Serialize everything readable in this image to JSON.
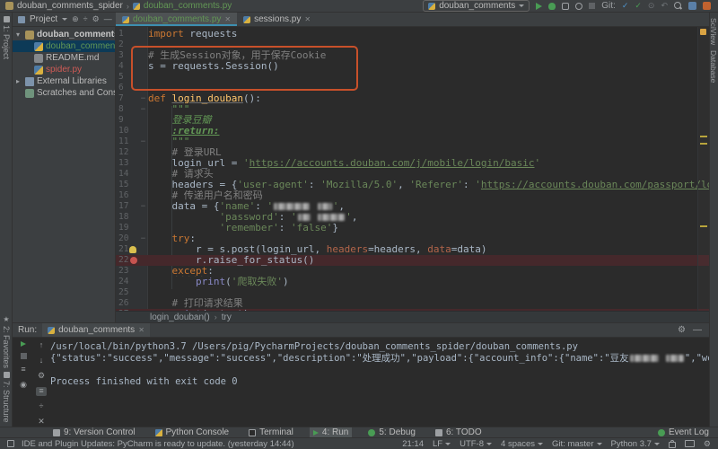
{
  "icons": {
    "close": "✕",
    "collapse": "÷",
    "gear": "⚙",
    "minus": "—",
    "check": "✓",
    "undo": "↶",
    "circle": "⊙",
    "up": "↑",
    "down": "↓",
    "star": "★",
    "sep": "›",
    "fold": "−",
    "menu": "≡",
    "pin": "◉",
    "print": "⎙",
    "trash": "🗑",
    "locate": "⊕"
  },
  "title_bar": {
    "project": "douban_comments_spider",
    "file": "douban_comments.py",
    "run_config": "douban_comments",
    "git_label": "Git:"
  },
  "project_panel": {
    "header": "Project",
    "tree": [
      {
        "label": "douban_comments_spider",
        "icon": "folder",
        "arrow": "down",
        "bold": true,
        "color": "default",
        "indent": 0,
        "selected": false
      },
      {
        "label": "douban_comments.py",
        "icon": "pyfile",
        "arrow": "",
        "bold": false,
        "color": "green",
        "indent": 1,
        "selected": true
      },
      {
        "label": "README.md",
        "icon": "file",
        "arrow": "",
        "bold": false,
        "color": "default",
        "indent": 1,
        "selected": false
      },
      {
        "label": "spider.py",
        "icon": "pyfile",
        "arrow": "",
        "bold": false,
        "color": "red",
        "indent": 1,
        "selected": false
      },
      {
        "label": "External Libraries",
        "icon": "lib",
        "arrow": "right",
        "bold": false,
        "color": "default",
        "indent": 0,
        "selected": false
      },
      {
        "label": "Scratches and Consoles",
        "icon": "scr",
        "arrow": "",
        "bold": false,
        "color": "default",
        "indent": 0,
        "selected": false
      }
    ]
  },
  "left_stripe": {
    "top": "1: Project",
    "bottom": [
      "2: Favorites",
      "7: Structure"
    ]
  },
  "right_stripe": [
    "SciView",
    "Database"
  ],
  "editor_tabs": [
    {
      "label": "douban_comments.py",
      "active": true,
      "color": "green"
    },
    {
      "label": "sessions.py",
      "active": false,
      "color": "default"
    }
  ],
  "editor": {
    "breakpoint_lines": [
      22,
      27
    ],
    "lightbulb_lines": [
      21
    ],
    "fold_lines": [
      7,
      8,
      11,
      17,
      20
    ],
    "highlight_lines": [
      22,
      27
    ],
    "lines": [
      {
        "n": 1,
        "seg": [
          [
            "kw",
            "import"
          ],
          [
            "pl",
            " requests"
          ]
        ]
      },
      {
        "n": 2,
        "seg": []
      },
      {
        "n": 3,
        "seg": [
          [
            "com",
            "# 生成Session对象，用于保存Cookie"
          ]
        ]
      },
      {
        "n": 4,
        "seg": [
          [
            "pl",
            "s = requests.Session()"
          ]
        ]
      },
      {
        "n": 5,
        "seg": []
      },
      {
        "n": 6,
        "seg": []
      },
      {
        "n": 7,
        "seg": [
          [
            "kw",
            "def "
          ],
          [
            "fn",
            "login_douban"
          ],
          [
            "pl",
            "():"
          ]
        ]
      },
      {
        "n": 8,
        "seg": [
          [
            "doc",
            "    \"\"\""
          ]
        ]
      },
      {
        "n": 9,
        "seg": [
          [
            "doc",
            "    登录豆瓣"
          ]
        ]
      },
      {
        "n": 10,
        "seg": [
          [
            "pl",
            "    "
          ],
          [
            "doctag",
            ":return:"
          ]
        ]
      },
      {
        "n": 11,
        "seg": [
          [
            "doc",
            "    \"\"\""
          ]
        ]
      },
      {
        "n": 12,
        "seg": [
          [
            "com",
            "    # 登录URL"
          ]
        ]
      },
      {
        "n": 13,
        "seg": [
          [
            "pl",
            "    login_url = "
          ],
          [
            "str",
            "'"
          ],
          [
            "url",
            "https://accounts.douban.com/j/mobile/login/basic"
          ],
          [
            "str",
            "'"
          ]
        ]
      },
      {
        "n": 14,
        "seg": [
          [
            "com",
            "    # 请求头"
          ]
        ]
      },
      {
        "n": 15,
        "seg": [
          [
            "pl",
            "    headers = {"
          ],
          [
            "str",
            "'user-agent'"
          ],
          [
            "pl",
            ": "
          ],
          [
            "str",
            "'Mozilla/5.0'"
          ],
          [
            "pl",
            ", "
          ],
          [
            "str",
            "'Referer'"
          ],
          [
            "pl",
            ": "
          ],
          [
            "str",
            "'"
          ],
          [
            "url",
            "https://accounts.douban.com/passport/login?sou"
          ]
        ]
      },
      {
        "n": 16,
        "seg": [
          [
            "com",
            "    # 传递用户名和密码"
          ]
        ]
      },
      {
        "n": 17,
        "seg": [
          [
            "pl",
            "    data = {"
          ],
          [
            "str",
            "'name'"
          ],
          [
            "pl",
            ": "
          ],
          [
            "str",
            "'"
          ],
          [
            "blur",
            "40"
          ],
          [
            "pl",
            " "
          ],
          [
            "blur",
            "16"
          ],
          [
            "str",
            "'"
          ],
          [
            "pl",
            ","
          ]
        ]
      },
      {
        "n": 18,
        "seg": [
          [
            "pl",
            "            "
          ],
          [
            "str",
            "'password'"
          ],
          [
            "pl",
            ": "
          ],
          [
            "str",
            "'"
          ],
          [
            "blur",
            "14"
          ],
          [
            "pl",
            " "
          ],
          [
            "blur",
            "30"
          ],
          [
            "str",
            "'"
          ],
          [
            "pl",
            ","
          ]
        ]
      },
      {
        "n": 19,
        "seg": [
          [
            "pl",
            "            "
          ],
          [
            "str",
            "'remember'"
          ],
          [
            "pl",
            ": "
          ],
          [
            "str",
            "'false'"
          ],
          [
            "pl",
            "}"
          ]
        ]
      },
      {
        "n": 20,
        "seg": [
          [
            "pl",
            "    "
          ],
          [
            "kw",
            "try"
          ],
          [
            "pl",
            ":"
          ]
        ]
      },
      {
        "n": 21,
        "seg": [
          [
            "pl",
            "        r = "
          ],
          [
            "err",
            "s"
          ],
          [
            "pl",
            ".post(login_url, "
          ],
          [
            "ka",
            "headers"
          ],
          [
            "pl",
            "=headers, "
          ],
          [
            "ka",
            "data"
          ],
          [
            "pl",
            "=data)"
          ]
        ]
      },
      {
        "n": 22,
        "seg": [
          [
            "pl",
            "        r.raise_for_status()"
          ]
        ]
      },
      {
        "n": 23,
        "seg": [
          [
            "pl",
            "    "
          ],
          [
            "kww",
            "except"
          ],
          [
            "pl",
            ":"
          ]
        ]
      },
      {
        "n": 24,
        "seg": [
          [
            "pl",
            "        "
          ],
          [
            "bi",
            "print"
          ],
          [
            "pl",
            "("
          ],
          [
            "str",
            "'爬取失败'"
          ],
          [
            "pl",
            ")"
          ]
        ]
      },
      {
        "n": 25,
        "seg": []
      },
      {
        "n": 26,
        "seg": [
          [
            "com",
            "    # 打印请求结果"
          ]
        ]
      },
      {
        "n": 27,
        "seg": [
          [
            "pl",
            "    "
          ],
          [
            "bi",
            "print"
          ],
          [
            "pl",
            "(r.text)"
          ]
        ]
      }
    ]
  },
  "breadcrumbs": {
    "items": [
      "login_douban()",
      "try"
    ],
    "separator": "›"
  },
  "run_panel": {
    "label": "Run:",
    "tab": "douban_comments",
    "console": [
      {
        "seg": [
          [
            "pl",
            "/usr/local/bin/python3.7 /Users/pig/PycharmProjects/douban_comments_spider/douban_comments.py"
          ]
        ]
      },
      {
        "seg": [
          [
            "pl",
            "{\"status\":\"success\",\"message\":\"success\",\"description\":\"处理成功\",\"payload\":{\"account_info\":{\"name\":\"豆友"
          ],
          [
            "blur",
            "32"
          ],
          [
            "pl",
            " "
          ],
          [
            "blur",
            "20"
          ],
          [
            "pl",
            "\",\"weixin_"
          ]
        ]
      },
      {
        "seg": []
      },
      {
        "seg": [
          [
            "pl",
            "Process finished with exit code 0"
          ]
        ]
      }
    ]
  },
  "bottom_bar": {
    "tools": [
      {
        "label": "9: Version Control",
        "icon": "plain",
        "active": false
      },
      {
        "label": "Python Console",
        "icon": "py",
        "active": false
      },
      {
        "label": "Terminal",
        "icon": "term",
        "active": false
      },
      {
        "label": "4: Run",
        "icon": "run",
        "active": true
      },
      {
        "label": "5: Debug",
        "icon": "debug",
        "active": false
      },
      {
        "label": "6: TODO",
        "icon": "plain",
        "active": false
      }
    ],
    "event_log": "Event Log"
  },
  "status_bar": {
    "message": "IDE and Plugin Updates: PyCharm is ready to update. (yesterday 14:44)",
    "items": [
      "21:14",
      "LF",
      "UTF-8",
      "4 spaces",
      "Git: master",
      "Python 3.7"
    ]
  }
}
